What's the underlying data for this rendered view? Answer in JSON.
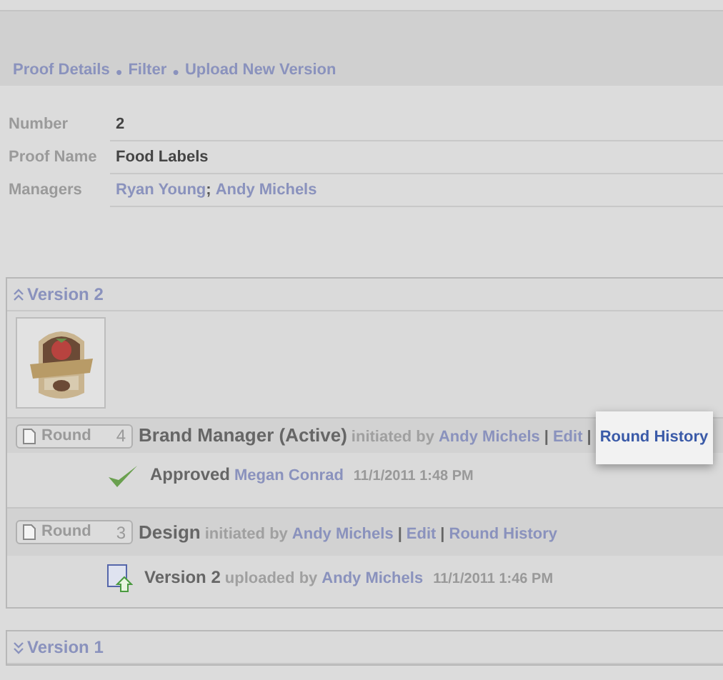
{
  "toolbar": {
    "links": [
      "Proof Details",
      "Filter",
      "Upload New Version"
    ],
    "separator": "●"
  },
  "details": [
    {
      "label": "Number",
      "value": "2",
      "kind": "text"
    },
    {
      "label": "Proof Name",
      "value": "Food Labels",
      "kind": "text"
    },
    {
      "label": "Managers",
      "values": [
        "Ryan Young",
        "Andy Michels"
      ],
      "separator": ";",
      "kind": "links"
    }
  ],
  "versions": [
    {
      "title": "Version 2",
      "expanded": true,
      "thumbnail": {
        "kind": "picture"
      },
      "rounds": [
        {
          "badge_label": "Round",
          "number": "4",
          "title": "Brand Manager (Active)",
          "initiated_text": "initiated by",
          "initiator": "Andy Michels",
          "link_separator": "|",
          "links": [
            {
              "label": "Edit",
              "highlighted": false
            },
            {
              "label": "Round History",
              "highlighted": true
            }
          ],
          "events": [
            {
              "kind": "approved",
              "title": "Approved",
              "person": "Megan Conrad",
              "time": "11/1/2011 1:48 PM"
            }
          ]
        },
        {
          "badge_label": "Round",
          "number": "3",
          "title": "Design",
          "initiated_text": "initiated by",
          "initiator": "Andy Michels",
          "link_separator": "|",
          "links": [
            {
              "label": "Edit",
              "highlighted": false
            },
            {
              "label": "Round History",
              "highlighted": false
            }
          ],
          "events": [
            {
              "kind": "uploaded",
              "title": "Version 2",
              "text": "uploaded by",
              "person": "Andy Michels",
              "time": "11/1/2011 1:46 PM"
            }
          ]
        }
      ]
    },
    {
      "title": "Version 1",
      "expanded": false
    }
  ]
}
